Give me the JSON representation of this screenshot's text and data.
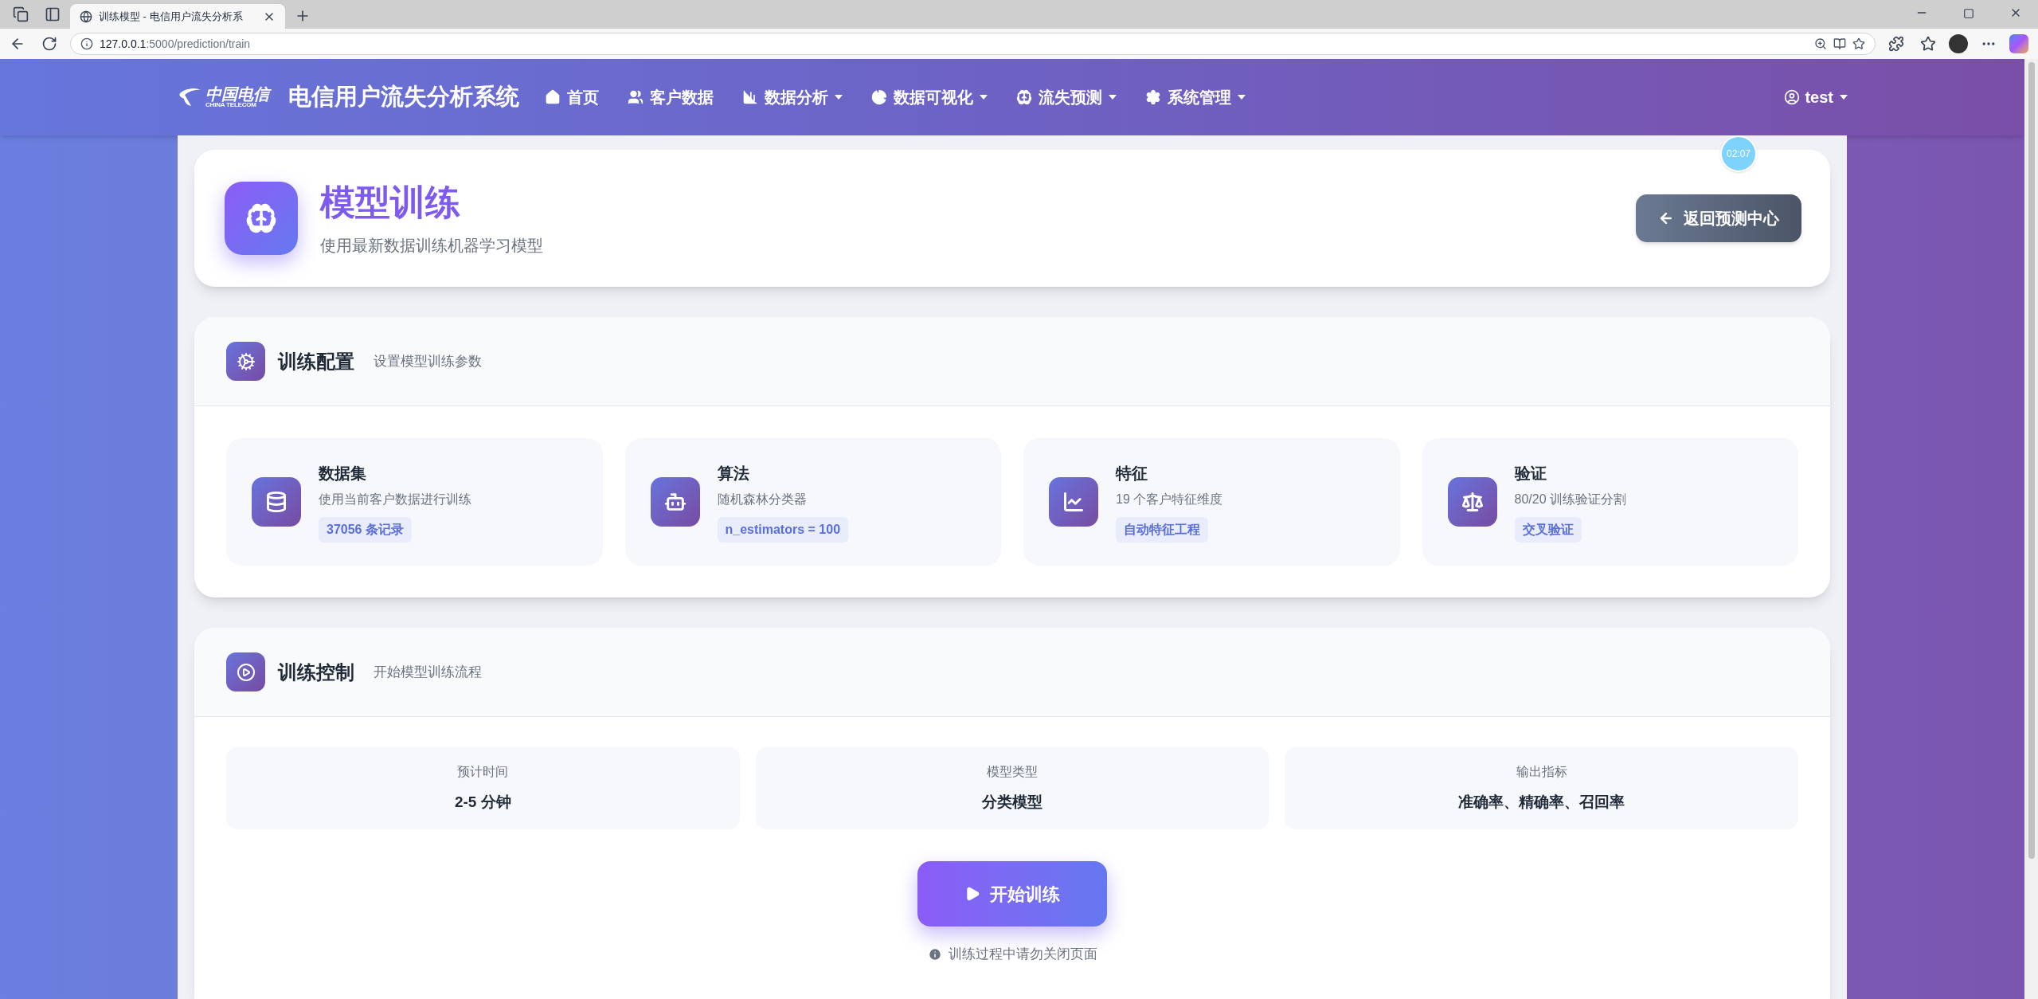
{
  "browser": {
    "tab_title": "训练模型 - 电信用户流失分析系",
    "url_host": "127.0.0.1",
    "url_path": ":5000/prediction/train"
  },
  "navbar": {
    "logo_cn": "中国电信",
    "logo_en": "CHINA TELECOM",
    "brand": "电信用户流失分析系统",
    "items": [
      {
        "label": "首页",
        "dropdown": false
      },
      {
        "label": "客户数据",
        "dropdown": false
      },
      {
        "label": "数据分析",
        "dropdown": true
      },
      {
        "label": "数据可视化",
        "dropdown": true
      },
      {
        "label": "流失预测",
        "dropdown": true
      },
      {
        "label": "系统管理",
        "dropdown": true
      }
    ],
    "user": {
      "name": "test",
      "dropdown": true
    }
  },
  "header": {
    "title": "模型训练",
    "subtitle": "使用最新数据训练机器学习模型",
    "back_button": "返回预测中心",
    "timer": "02:07"
  },
  "config": {
    "title": "训练配置",
    "subtitle": "设置模型训练参数",
    "items": [
      {
        "title": "数据集",
        "desc": "使用当前客户数据进行训练",
        "tag": "37056 条记录"
      },
      {
        "title": "算法",
        "desc": "随机森林分类器",
        "tag": "n_estimators = 100"
      },
      {
        "title": "特征",
        "desc": "19 个客户特征维度",
        "tag": "自动特征工程"
      },
      {
        "title": "验证",
        "desc": "80/20 训练验证分割",
        "tag": "交叉验证"
      }
    ]
  },
  "control": {
    "title": "训练控制",
    "subtitle": "开始模型训练流程",
    "stats": [
      {
        "label": "预计时间",
        "value": "2-5 分钟"
      },
      {
        "label": "模型类型",
        "value": "分类模型"
      },
      {
        "label": "输出指标",
        "value": "准确率、精确率、召回率"
      }
    ],
    "start_button": "开始训练",
    "note": "训练过程中请勿关闭页面"
  }
}
